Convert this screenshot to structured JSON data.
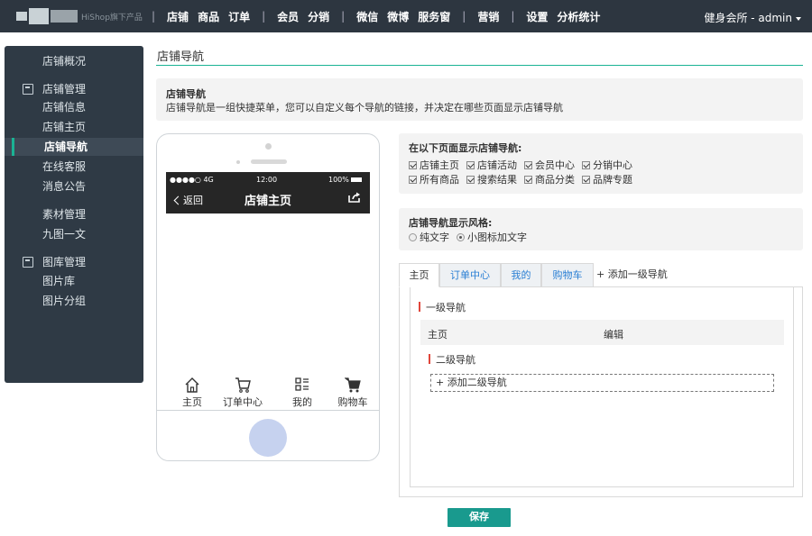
{
  "header": {
    "logo_sub": "HiShop旗下产品",
    "nav": [
      {
        "label": "店铺",
        "active": true
      },
      {
        "label": "商品"
      },
      {
        "label": "订单"
      },
      {
        "label": "会员"
      },
      {
        "label": "分销"
      },
      {
        "label": "微信"
      },
      {
        "label": "微博"
      },
      {
        "label": "服务窗"
      },
      {
        "label": "营销"
      },
      {
        "label": "设置"
      },
      {
        "label": "分析统计"
      }
    ],
    "account": "健身会所 - admin"
  },
  "sidebar": {
    "items": [
      {
        "label": "店铺概况"
      },
      {
        "label": "店铺管理",
        "group": true,
        "icon": "store-icon"
      },
      {
        "label": "店铺信息"
      },
      {
        "label": "店铺主页"
      },
      {
        "label": "店铺导航",
        "active": true
      },
      {
        "label": "在线客服"
      },
      {
        "label": "消息公告"
      },
      {
        "label": "素材管理"
      },
      {
        "label": "九图一文"
      },
      {
        "label": "图库管理",
        "group": true,
        "icon": "image-icon"
      },
      {
        "label": "图片库"
      },
      {
        "label": "图片分组"
      }
    ]
  },
  "page": {
    "title": "店铺导航",
    "info_heading": "店铺导航",
    "info_desc": "店铺导航是一组快捷菜单，您可以自定义每个导航的链接，并决定在哪些页面显示店铺导航"
  },
  "phone": {
    "status_left": "●●●●○ 4G",
    "status_time": "12:00",
    "status_right": "100%",
    "back": "返回",
    "screen_title": "店铺主页",
    "tabbar": [
      {
        "label": "主页",
        "icon": "home-icon"
      },
      {
        "label": "订单中心",
        "icon": "cart-outline-icon"
      },
      {
        "label": "我的",
        "icon": "grid-list-icon"
      },
      {
        "label": "购物车",
        "icon": "cart-filled-icon"
      }
    ]
  },
  "display_pages": {
    "heading": "在以下页面显示店铺导航:",
    "row1": [
      "店铺主页",
      "店铺活动",
      "会员中心",
      "分销中心"
    ],
    "row2": [
      "所有商品",
      "搜索结果",
      "商品分类",
      "品牌专题"
    ]
  },
  "style": {
    "heading": "店铺导航显示风格:",
    "options": [
      {
        "label": "纯文字",
        "selected": false
      },
      {
        "label": "小图标加文字",
        "selected": true
      }
    ]
  },
  "tabs": {
    "items": [
      {
        "label": "主页",
        "active": true
      },
      {
        "label": "订单中心"
      },
      {
        "label": "我的"
      },
      {
        "label": "购物车"
      }
    ],
    "add_label": "+ 添加一级导航"
  },
  "editor": {
    "level1_label": "一级导航",
    "row_name": "主页",
    "row_action": "编辑",
    "level2_label": "二级导航",
    "add_level2": "+ 添加二级导航"
  },
  "save_label": "保存",
  "colors": {
    "topbar": "#2d3640",
    "sidebar": "#2f3a45",
    "accent": "#1ab394",
    "save": "#199a8e"
  }
}
